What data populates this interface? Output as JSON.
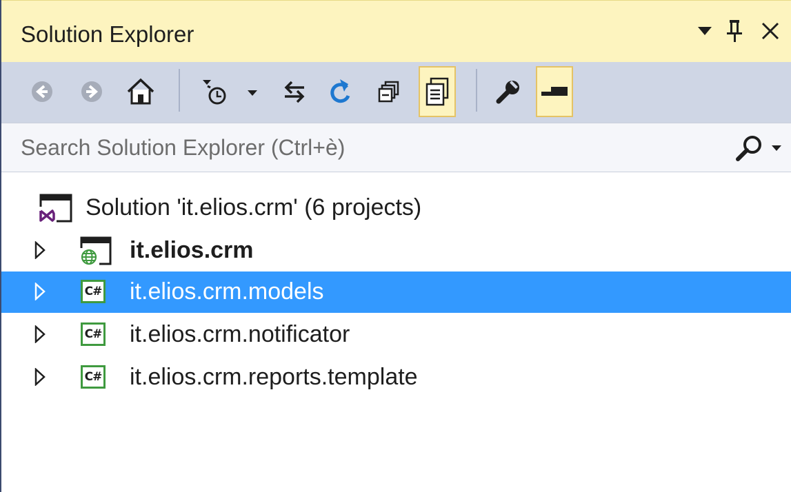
{
  "panel": {
    "title": "Solution Explorer"
  },
  "title_controls": [
    {
      "name": "window-position-dropdown-icon"
    },
    {
      "name": "pin-icon"
    },
    {
      "name": "close-icon"
    }
  ],
  "toolbar": {
    "buttons": [
      {
        "name": "back-icon",
        "active": false
      },
      {
        "name": "forward-icon",
        "active": false
      },
      {
        "name": "home-icon",
        "active": false
      },
      {
        "name": "pending-changes-filter-icon",
        "active": false
      },
      {
        "name": "sync-with-active-document-icon",
        "active": false
      },
      {
        "name": "refresh-icon",
        "active": false
      },
      {
        "name": "collapse-all-icon",
        "active": false
      },
      {
        "name": "show-all-files-icon",
        "active": true
      },
      {
        "name": "properties-wrench-icon",
        "active": false
      },
      {
        "name": "preview-selected-items-icon",
        "active": true
      }
    ]
  },
  "search": {
    "placeholder": "Search Solution Explorer (Ctrl+è)"
  },
  "tree": {
    "items": [
      {
        "label": "Solution 'it.elios.crm' (6 projects)",
        "icon": "visual-studio-solution-icon",
        "expandable": false,
        "selected": false,
        "bold": false
      },
      {
        "label": "it.elios.crm",
        "icon": "web-project-icon",
        "expandable": true,
        "selected": false,
        "bold": true
      },
      {
        "label": "it.elios.crm.models",
        "icon": "csharp-project-icon",
        "icon_text": "C#",
        "expandable": true,
        "selected": true,
        "bold": false
      },
      {
        "label": "it.elios.crm.notificator",
        "icon": "csharp-project-icon",
        "icon_text": "C#",
        "expandable": true,
        "selected": false,
        "bold": false
      },
      {
        "label": "it.elios.crm.reports.template",
        "icon": "csharp-project-icon",
        "icon_text": "C#",
        "expandable": true,
        "selected": false,
        "bold": false
      }
    ]
  },
  "colors": {
    "title_bar": "#fdf4bf",
    "toolbar": "#cfd6e5",
    "selection": "#3399ff",
    "csharp_icon_border": "#3f9a3f",
    "refresh_icon": "#1e78d0",
    "vs_purple": "#68217a"
  }
}
